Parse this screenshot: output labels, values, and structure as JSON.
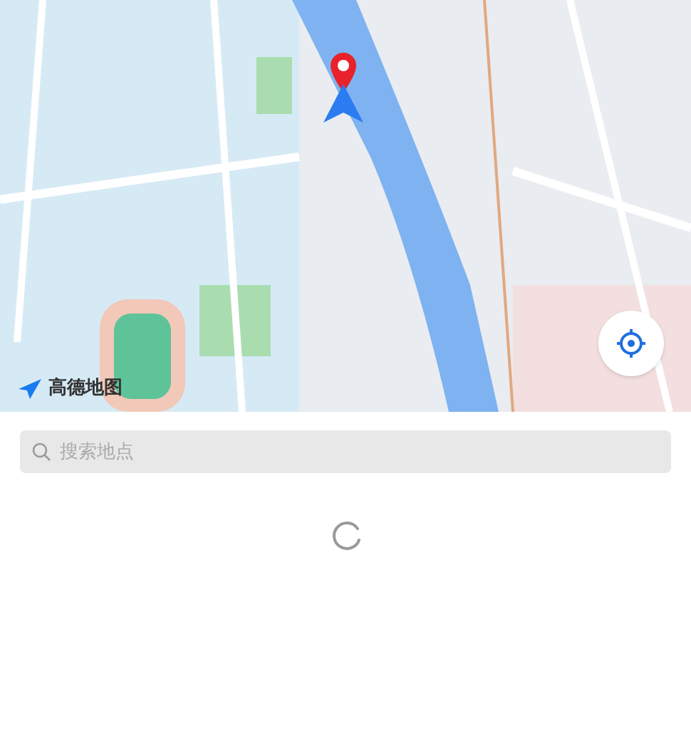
{
  "map": {
    "logo": "高德地图"
  },
  "search": {
    "placeholder": "搜索地点"
  },
  "loading": true
}
